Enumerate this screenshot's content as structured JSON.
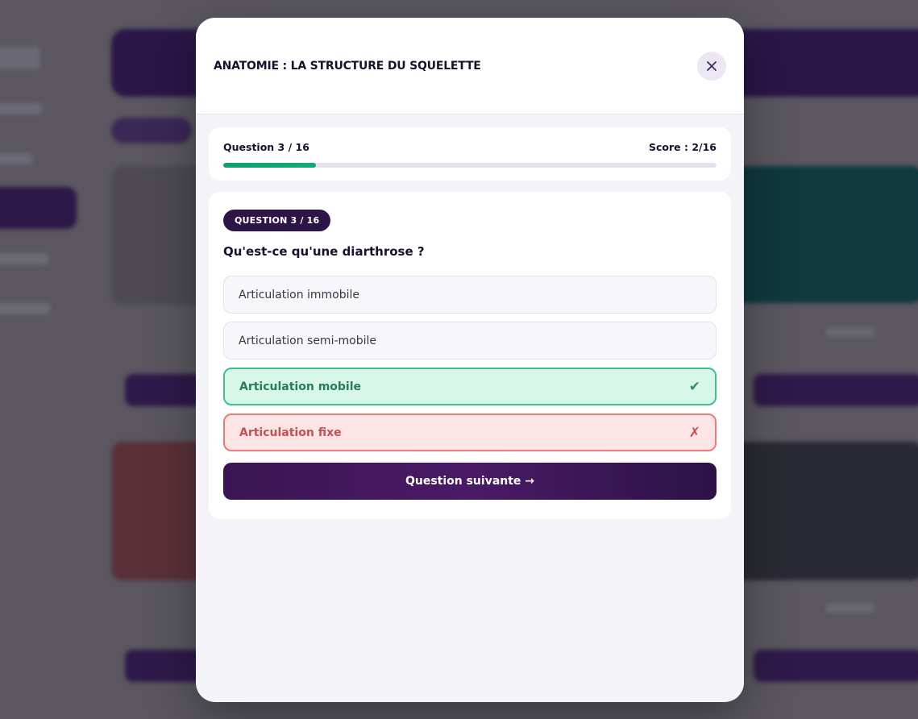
{
  "modal": {
    "title": "ANATOMIE : LA STRUCTURE DU SQUELETTE",
    "close_icon": "close-icon"
  },
  "progress": {
    "label": "Question 3 / 16",
    "score": "Score : 2/16",
    "current": 3,
    "total": 16,
    "fraction": 0.1875
  },
  "question": {
    "badge": "QUESTION 3 / 16",
    "text": "Qu'est-ce qu'une diarthrose ?",
    "options": [
      {
        "label": "Articulation immobile",
        "state": "neutral",
        "mark": ""
      },
      {
        "label": "Articulation semi-mobile",
        "state": "neutral",
        "mark": ""
      },
      {
        "label": "Articulation mobile",
        "state": "correct",
        "mark": "✔"
      },
      {
        "label": "Articulation fixe",
        "state": "wrong",
        "mark": "✗"
      }
    ],
    "next_label": "Question suivante →"
  },
  "colors": {
    "brand": "#2d1547",
    "correct": "#3fbf8a",
    "wrong": "#ef7a7a",
    "progress": "#0e9f6e"
  }
}
